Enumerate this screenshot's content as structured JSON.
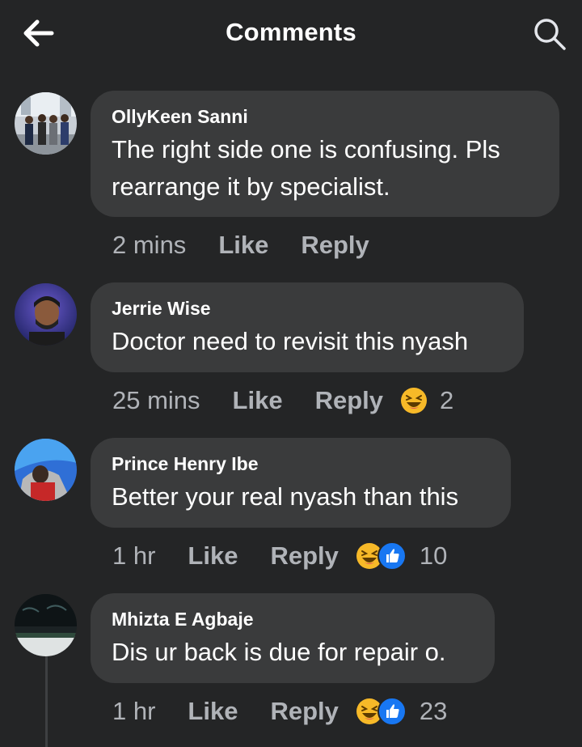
{
  "header": {
    "title": "Comments"
  },
  "comments": [
    {
      "author": "OllyKeen Sanni",
      "text_line1": "The right side one is confusing. Pls",
      "text_line2": "rearrange it by specialist.",
      "time": "2 mins",
      "like_label": "Like",
      "reply_label": "Reply",
      "reaction_count": ""
    },
    {
      "author": "Jerrie Wise",
      "text_line1": "Doctor need to revisit this nyash",
      "time": "25 mins",
      "like_label": "Like",
      "reply_label": "Reply",
      "reaction_count": "2",
      "reactions": [
        "haha-emoji"
      ]
    },
    {
      "author": "Prince Henry Ibe",
      "text_line1": "Better your real nyash than this",
      "time": "1 hr",
      "like_label": "Like",
      "reply_label": "Reply",
      "reaction_count": "10",
      "reactions": [
        "haha-emoji",
        "like-emoji"
      ]
    },
    {
      "author": "Mhizta E Agbaje",
      "text_line1": "Dis ur back is due for repair o.",
      "time": "1 hr",
      "like_label": "Like",
      "reply_label": "Reply",
      "reaction_count": "23",
      "reactions": [
        "haha-emoji",
        "like-emoji"
      ]
    }
  ],
  "colors": {
    "background": "#242526",
    "bubble": "#3a3b3c",
    "secondary_text": "#b0b3b8",
    "like_blue": "#1877f2",
    "haha_yellow": "#f7b928"
  }
}
